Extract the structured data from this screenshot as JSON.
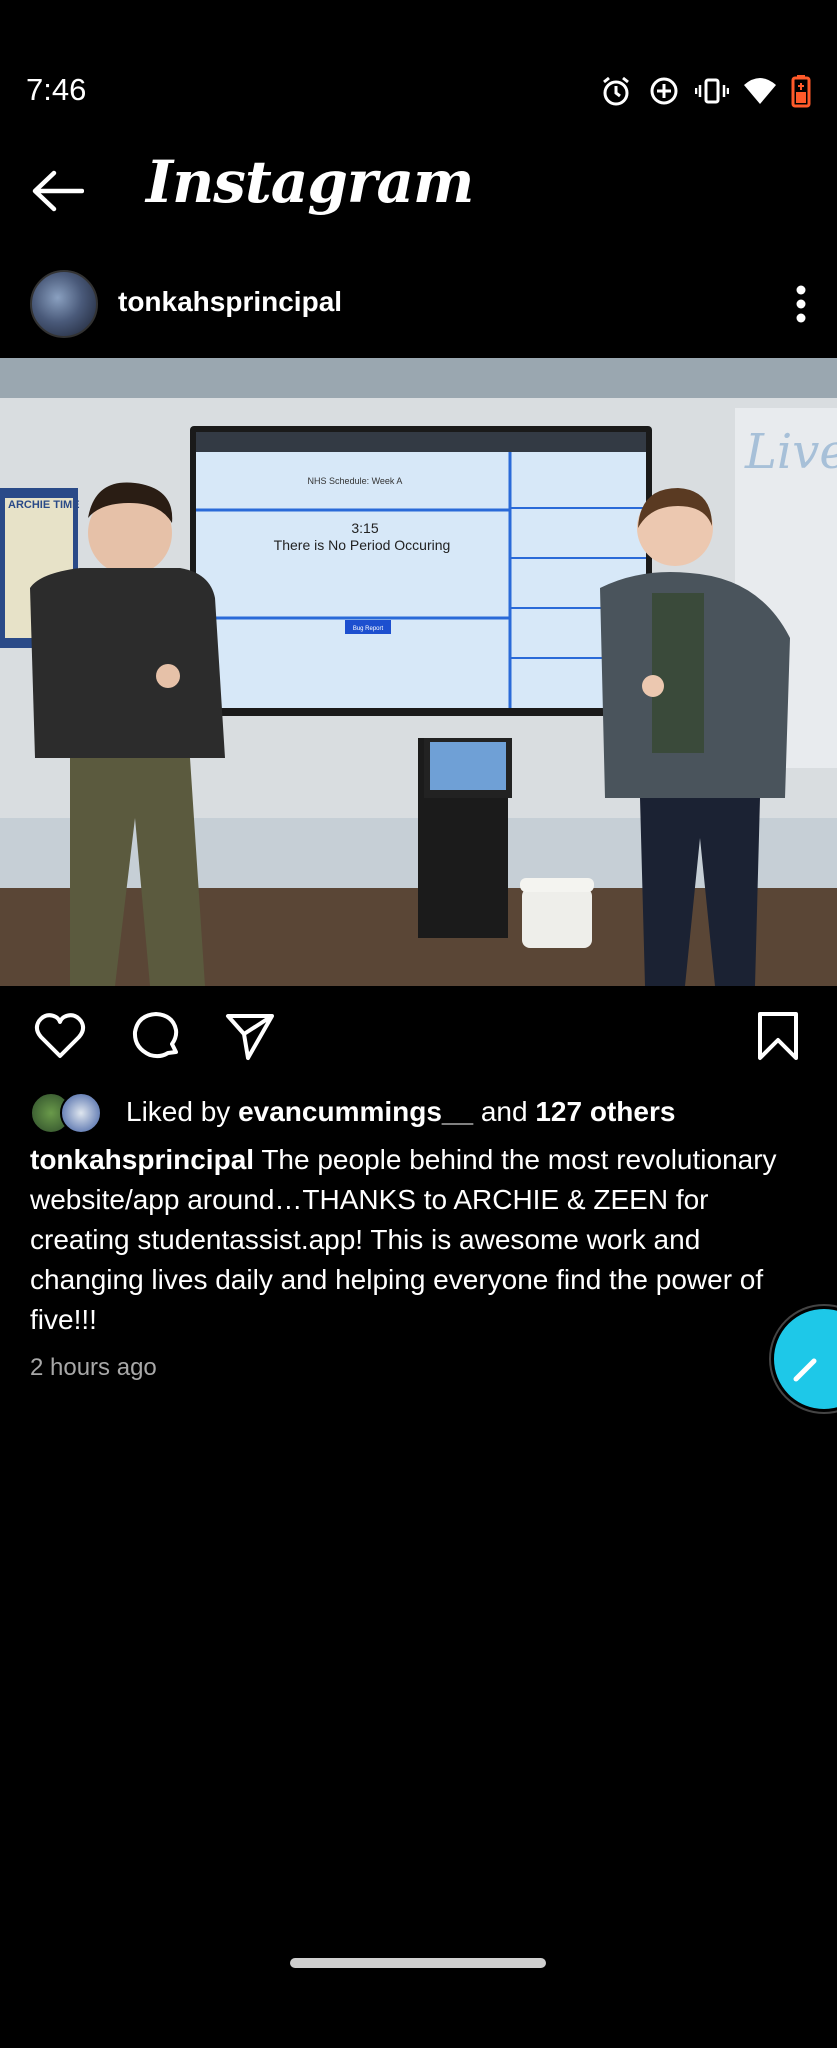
{
  "status_bar": {
    "time": "7:46"
  },
  "header": {
    "title": "Instagram"
  },
  "post": {
    "username": "tonkahsprincipal",
    "likes": {
      "prefix": "Liked by ",
      "user": "evancummings__",
      "middle": " and ",
      "others": "127 others"
    },
    "caption": {
      "username": "tonkahsprincipal",
      "text": " The people behind the most revolutionary website/app around…THANKS to ARCHIE & ZEEN for creating studentassist.app!  This is awesome work and changing lives daily and helping everyone find the power of five!!!"
    },
    "time_ago": "2 hours ago"
  },
  "photo": {
    "tv_title": "NHS Schedule: Week A",
    "tv_time": "3:15",
    "tv_status": "There is No Period Occuring",
    "tv_button": "Bug Report",
    "sticker": "ARCHIE TIME"
  }
}
